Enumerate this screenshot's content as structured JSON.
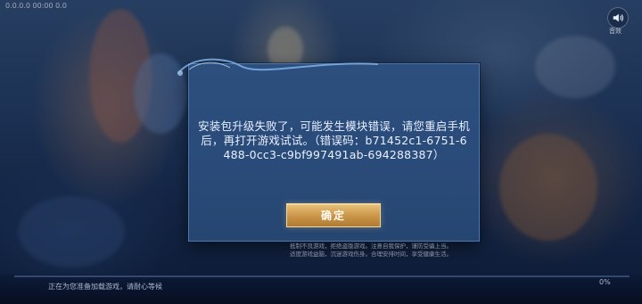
{
  "status_bar": {
    "text": "0.0.0.0  00:00  0.0"
  },
  "sound_button": {
    "icon": "speaker-icon",
    "label": "音效"
  },
  "dialog": {
    "message": "安装包升级失败了，可能发生模块错误，请您重启手机后，再打开游戏试试。（错误码：b71452c1-6751-6488-0cc3-c9bf997491ab-694288387）",
    "ok_label": "确定"
  },
  "notice": {
    "line1": "抵制不良游戏，拒绝盗版游戏。注意自我保护，谨防受骗上当。",
    "line2": "适度游戏益脑，沉迷游戏伤身。合理安排时间，享受健康生活。"
  },
  "loading": {
    "text": "正在为您准备加载游戏，请耐心等候",
    "percent_label": "0%",
    "progress": 0
  },
  "colors": {
    "accent_gold": "#c99447",
    "dialog_bg": "#2a4b79"
  }
}
